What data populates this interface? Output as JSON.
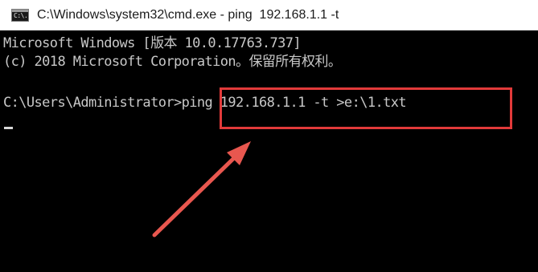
{
  "window": {
    "title": "C:\\Windows\\system32\\cmd.exe - ping  192.168.1.1 -t",
    "icon_label": "C:\\."
  },
  "console": {
    "lines": [
      "Microsoft Windows [版本 10.0.17763.737]",
      "(c) 2018 Microsoft Corporation。保留所有权利。",
      "C:\\Users\\Administrator>ping 192.168.1.1 -t >e:\\1.txt"
    ]
  },
  "annotation": {
    "highlight_color": "#e23a3a",
    "arrow_color": "#e8574f"
  },
  "colors": {
    "console_bg": "#000000",
    "console_text": "#c8c8c8",
    "titlebar_bg": "#ffffff"
  }
}
